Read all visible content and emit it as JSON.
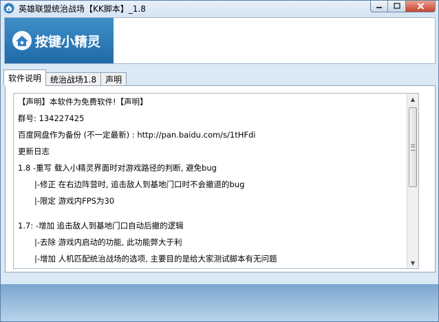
{
  "window": {
    "title": "英雄联盟统治战场【KK脚本】_1.8"
  },
  "banner": {
    "logo_text": "按键小精灵"
  },
  "tabs": [
    {
      "label": "软件说明",
      "active": true
    },
    {
      "label": "统治战场1.8",
      "active": false
    },
    {
      "label": "声明",
      "active": false
    }
  ],
  "content": {
    "lines": [
      {
        "text": "【声明】本软件为免费软件!【声明】"
      },
      {
        "text": "群号: 134227425"
      },
      {
        "text": "百度网盘作为备份 (不一定最新) : http://pan.baidu.com/s/1tHFdi"
      },
      {
        "text": "更新日志"
      },
      {
        "text": "1.8  -重写 载入小精灵界面时对游戏路径的判断, 避免bug"
      },
      {
        "text": "|-修正 在右边阵营时, 追击敌人到基地门口时不会撤退的bug"
      },
      {
        "text": "|-限定 游戏内FPS为30"
      },
      {
        "text": "1.7: -增加 追击敌人到基地门口自动后撤的逻辑"
      },
      {
        "text": "|-去除 游戏内启动的功能, 此功能弊大于利"
      },
      {
        "text": "|-增加 人机匹配统治战场的选项, 主要目的是给大家测试脚本有无问题"
      }
    ]
  },
  "colors": {
    "title_bar": "#dce8f5",
    "banner_blue": "#2e7fbf",
    "close_button": "#c7432c",
    "footer": "#8fb6da"
  }
}
